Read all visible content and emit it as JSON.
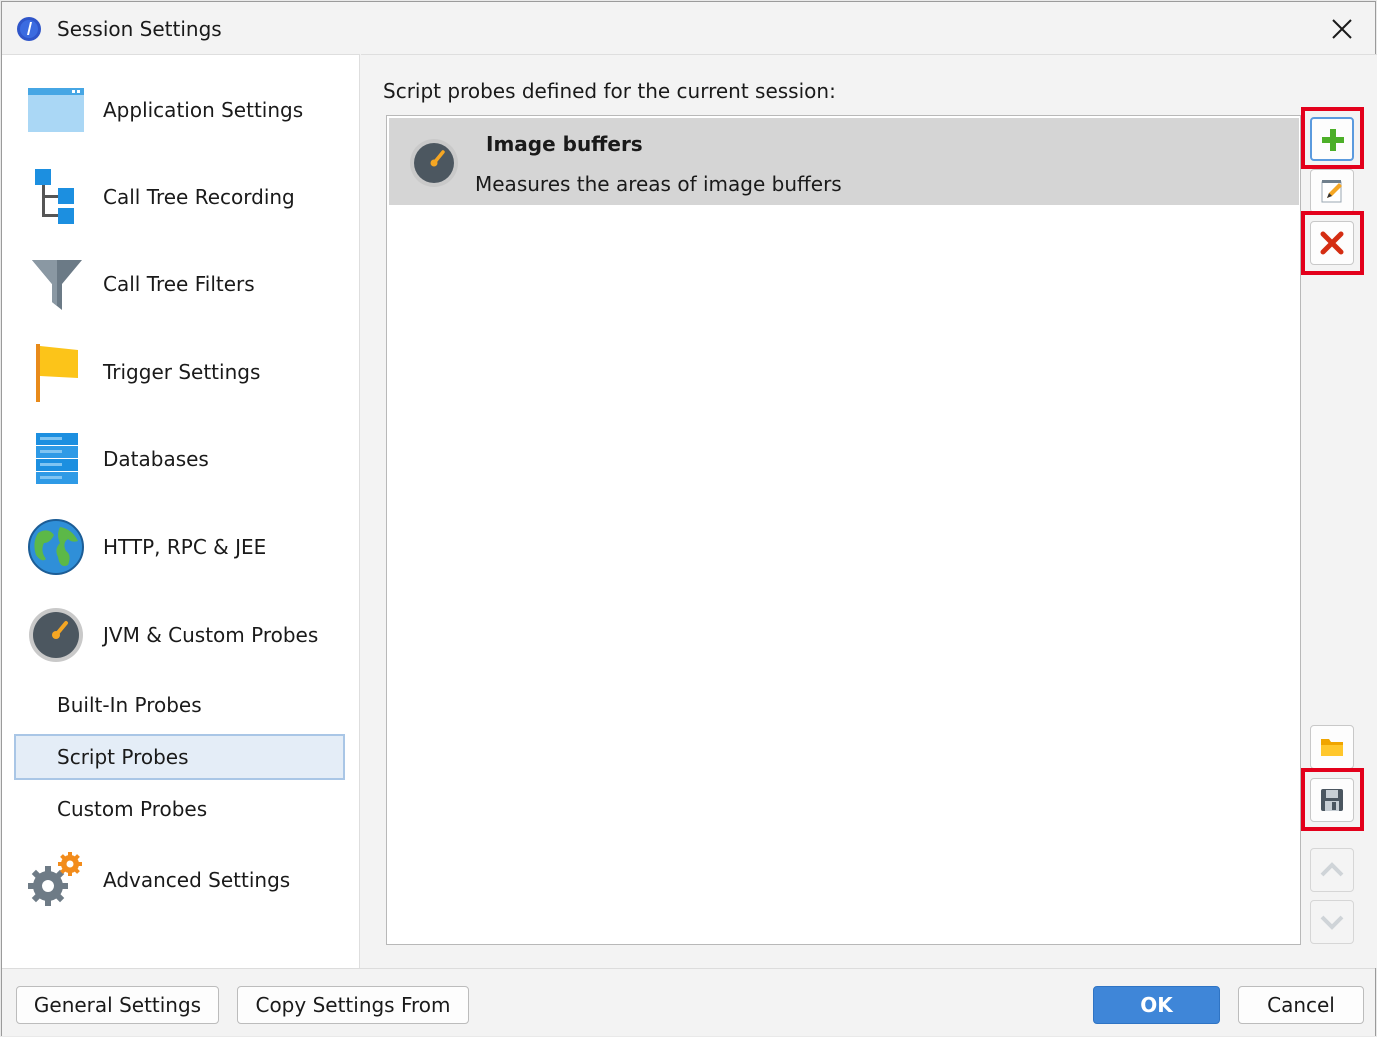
{
  "window": {
    "title": "Session Settings"
  },
  "sidebar": {
    "items": [
      {
        "label": "Application Settings"
      },
      {
        "label": "Call Tree Recording"
      },
      {
        "label": "Call Tree Filters"
      },
      {
        "label": "Trigger Settings"
      },
      {
        "label": "Databases"
      },
      {
        "label": "HTTP, RPC & JEE"
      },
      {
        "label": "JVM & Custom Probes"
      }
    ],
    "sub_items": [
      {
        "label": "Built-In Probes"
      },
      {
        "label": "Script Probes",
        "selected": true
      },
      {
        "label": "Custom Probes"
      }
    ],
    "advanced": {
      "label": "Advanced Settings"
    }
  },
  "main": {
    "heading": "Script probes defined for the current session:",
    "probes": [
      {
        "title": "Image buffers",
        "description": "Measures the areas of image buffers"
      }
    ]
  },
  "toolbar": {
    "icons": [
      "add-icon",
      "edit-icon",
      "delete-icon",
      "open-folder-icon",
      "save-icon",
      "move-up-icon",
      "move-down-icon"
    ]
  },
  "footer": {
    "general_settings": "General Settings",
    "copy_settings_from": "Copy Settings From",
    "ok": "OK",
    "cancel": "Cancel"
  },
  "colors": {
    "highlight": "#e3001b",
    "primary_button": "#3f86d8",
    "selection": "#e4edf7",
    "selected_row": "#d5d5d5"
  }
}
